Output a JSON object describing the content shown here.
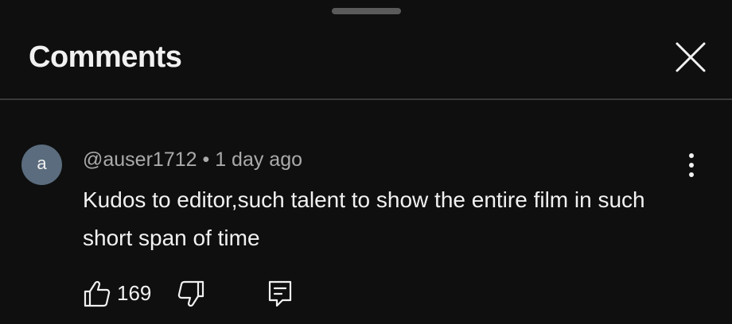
{
  "panel": {
    "title": "Comments"
  },
  "comment": {
    "avatar_letter": "a",
    "author": "@auser1712",
    "separator": " • ",
    "time": "1 day ago",
    "text": "Kudos to editor,such talent to show the entire film in such short span of time",
    "like_count": "169"
  },
  "icons": {
    "close": "close-icon",
    "more": "more-vert-icon",
    "like": "thumb-up-icon",
    "dislike": "thumb-down-icon",
    "reply": "reply-comment-icon"
  },
  "colors": {
    "background": "#0f0f0f",
    "text_primary": "#f1f1f1",
    "text_secondary": "#aaaaaa",
    "avatar": "#5a6c7d",
    "divider": "#3a3a3a"
  }
}
